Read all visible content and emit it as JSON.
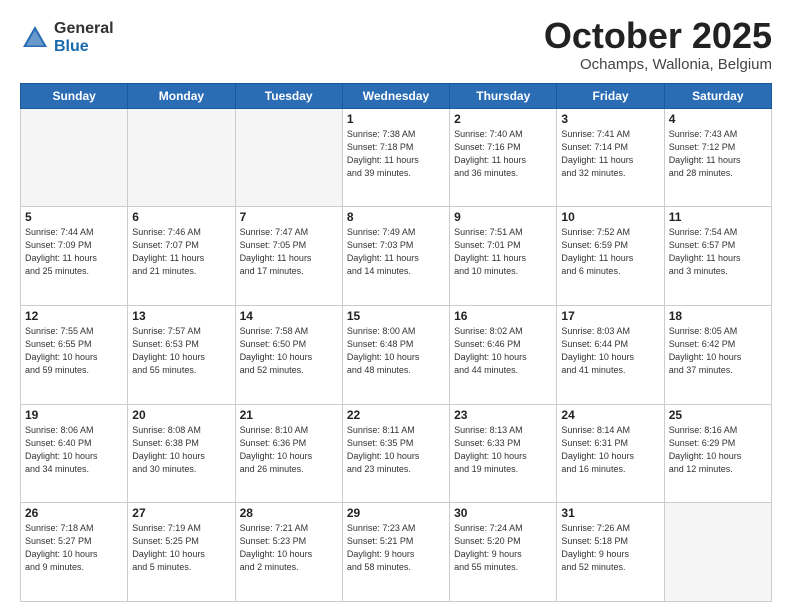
{
  "logo": {
    "general": "General",
    "blue": "Blue"
  },
  "title": "October 2025",
  "subtitle": "Ochamps, Wallonia, Belgium",
  "days_of_week": [
    "Sunday",
    "Monday",
    "Tuesday",
    "Wednesday",
    "Thursday",
    "Friday",
    "Saturday"
  ],
  "weeks": [
    [
      {
        "day": "",
        "info": ""
      },
      {
        "day": "",
        "info": ""
      },
      {
        "day": "",
        "info": ""
      },
      {
        "day": "1",
        "info": "Sunrise: 7:38 AM\nSunset: 7:18 PM\nDaylight: 11 hours\nand 39 minutes."
      },
      {
        "day": "2",
        "info": "Sunrise: 7:40 AM\nSunset: 7:16 PM\nDaylight: 11 hours\nand 36 minutes."
      },
      {
        "day": "3",
        "info": "Sunrise: 7:41 AM\nSunset: 7:14 PM\nDaylight: 11 hours\nand 32 minutes."
      },
      {
        "day": "4",
        "info": "Sunrise: 7:43 AM\nSunset: 7:12 PM\nDaylight: 11 hours\nand 28 minutes."
      }
    ],
    [
      {
        "day": "5",
        "info": "Sunrise: 7:44 AM\nSunset: 7:09 PM\nDaylight: 11 hours\nand 25 minutes."
      },
      {
        "day": "6",
        "info": "Sunrise: 7:46 AM\nSunset: 7:07 PM\nDaylight: 11 hours\nand 21 minutes."
      },
      {
        "day": "7",
        "info": "Sunrise: 7:47 AM\nSunset: 7:05 PM\nDaylight: 11 hours\nand 17 minutes."
      },
      {
        "day": "8",
        "info": "Sunrise: 7:49 AM\nSunset: 7:03 PM\nDaylight: 11 hours\nand 14 minutes."
      },
      {
        "day": "9",
        "info": "Sunrise: 7:51 AM\nSunset: 7:01 PM\nDaylight: 11 hours\nand 10 minutes."
      },
      {
        "day": "10",
        "info": "Sunrise: 7:52 AM\nSunset: 6:59 PM\nDaylight: 11 hours\nand 6 minutes."
      },
      {
        "day": "11",
        "info": "Sunrise: 7:54 AM\nSunset: 6:57 PM\nDaylight: 11 hours\nand 3 minutes."
      }
    ],
    [
      {
        "day": "12",
        "info": "Sunrise: 7:55 AM\nSunset: 6:55 PM\nDaylight: 10 hours\nand 59 minutes."
      },
      {
        "day": "13",
        "info": "Sunrise: 7:57 AM\nSunset: 6:53 PM\nDaylight: 10 hours\nand 55 minutes."
      },
      {
        "day": "14",
        "info": "Sunrise: 7:58 AM\nSunset: 6:50 PM\nDaylight: 10 hours\nand 52 minutes."
      },
      {
        "day": "15",
        "info": "Sunrise: 8:00 AM\nSunset: 6:48 PM\nDaylight: 10 hours\nand 48 minutes."
      },
      {
        "day": "16",
        "info": "Sunrise: 8:02 AM\nSunset: 6:46 PM\nDaylight: 10 hours\nand 44 minutes."
      },
      {
        "day": "17",
        "info": "Sunrise: 8:03 AM\nSunset: 6:44 PM\nDaylight: 10 hours\nand 41 minutes."
      },
      {
        "day": "18",
        "info": "Sunrise: 8:05 AM\nSunset: 6:42 PM\nDaylight: 10 hours\nand 37 minutes."
      }
    ],
    [
      {
        "day": "19",
        "info": "Sunrise: 8:06 AM\nSunset: 6:40 PM\nDaylight: 10 hours\nand 34 minutes."
      },
      {
        "day": "20",
        "info": "Sunrise: 8:08 AM\nSunset: 6:38 PM\nDaylight: 10 hours\nand 30 minutes."
      },
      {
        "day": "21",
        "info": "Sunrise: 8:10 AM\nSunset: 6:36 PM\nDaylight: 10 hours\nand 26 minutes."
      },
      {
        "day": "22",
        "info": "Sunrise: 8:11 AM\nSunset: 6:35 PM\nDaylight: 10 hours\nand 23 minutes."
      },
      {
        "day": "23",
        "info": "Sunrise: 8:13 AM\nSunset: 6:33 PM\nDaylight: 10 hours\nand 19 minutes."
      },
      {
        "day": "24",
        "info": "Sunrise: 8:14 AM\nSunset: 6:31 PM\nDaylight: 10 hours\nand 16 minutes."
      },
      {
        "day": "25",
        "info": "Sunrise: 8:16 AM\nSunset: 6:29 PM\nDaylight: 10 hours\nand 12 minutes."
      }
    ],
    [
      {
        "day": "26",
        "info": "Sunrise: 7:18 AM\nSunset: 5:27 PM\nDaylight: 10 hours\nand 9 minutes."
      },
      {
        "day": "27",
        "info": "Sunrise: 7:19 AM\nSunset: 5:25 PM\nDaylight: 10 hours\nand 5 minutes."
      },
      {
        "day": "28",
        "info": "Sunrise: 7:21 AM\nSunset: 5:23 PM\nDaylight: 10 hours\nand 2 minutes."
      },
      {
        "day": "29",
        "info": "Sunrise: 7:23 AM\nSunset: 5:21 PM\nDaylight: 9 hours\nand 58 minutes."
      },
      {
        "day": "30",
        "info": "Sunrise: 7:24 AM\nSunset: 5:20 PM\nDaylight: 9 hours\nand 55 minutes."
      },
      {
        "day": "31",
        "info": "Sunrise: 7:26 AM\nSunset: 5:18 PM\nDaylight: 9 hours\nand 52 minutes."
      },
      {
        "day": "",
        "info": ""
      }
    ]
  ]
}
